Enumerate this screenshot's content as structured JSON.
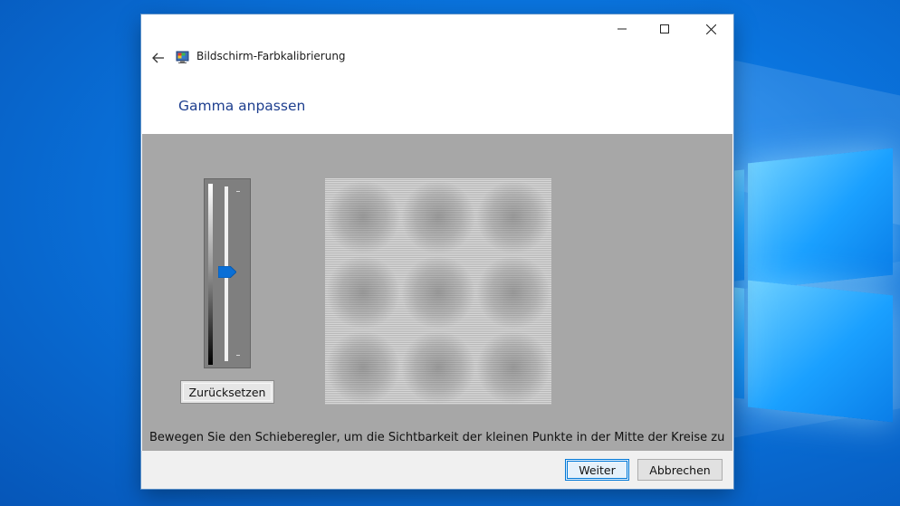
{
  "window": {
    "title": "Bildschirm-Farbkalibrierung",
    "heading": "Gamma anpassen",
    "controls": {
      "minimize_icon": "minimize-icon",
      "maximize_icon": "maximize-icon",
      "close_icon": "close-icon"
    },
    "back_icon": "back-arrow-icon",
    "app_icon": "display-color-calibration-icon"
  },
  "gamma": {
    "slider_level_fraction": 0.5,
    "reset_label": "Zurücksetzen",
    "instruction": "Bewegen Sie den Schieberegler, um die Sichtbarkeit der kleinen Punkte in der Mitte der Kreise zu"
  },
  "footer": {
    "next_label": "Weiter",
    "cancel_label": "Abbrechen"
  },
  "colors": {
    "accent": "#0078d7",
    "heading": "#1e3f8f",
    "calibration_background": "#a7a7a7"
  }
}
